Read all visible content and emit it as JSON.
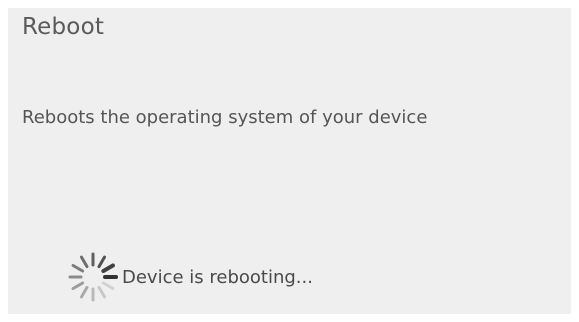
{
  "dialog": {
    "title": "Reboot",
    "description": "Reboots the operating system of your device"
  },
  "status": {
    "icon": "loading-spinner-icon",
    "text": "Device is rebooting..."
  },
  "colors": {
    "panel_background": "#efefef",
    "text": "#555555",
    "spinner": "#333333"
  }
}
